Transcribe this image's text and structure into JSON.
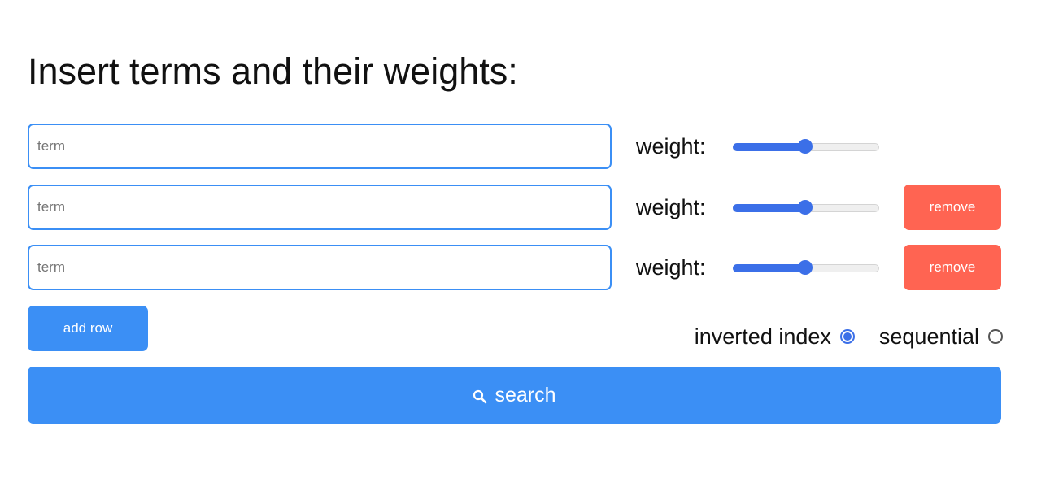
{
  "heading": "Insert terms and their weights:",
  "rows": [
    {
      "term_placeholder": "term",
      "term_value": "",
      "weight_label": "weight:",
      "weight": 0.5,
      "remove_label": ""
    },
    {
      "term_placeholder": "term",
      "term_value": "",
      "weight_label": "weight:",
      "weight": 0.5,
      "remove_label": "remove"
    },
    {
      "term_placeholder": "term",
      "term_value": "",
      "weight_label": "weight:",
      "weight": 0.5,
      "remove_label": "remove"
    }
  ],
  "add_row_label": "add row",
  "search_mode": {
    "options": [
      {
        "label": "inverted index",
        "checked": true
      },
      {
        "label": "sequential",
        "checked": false
      }
    ]
  },
  "search_button": {
    "label": "search",
    "icon": "search-icon"
  },
  "colors": {
    "primary": "#3b8ff5",
    "slider_accent": "#3b6fe8",
    "danger": "#ff6452"
  }
}
